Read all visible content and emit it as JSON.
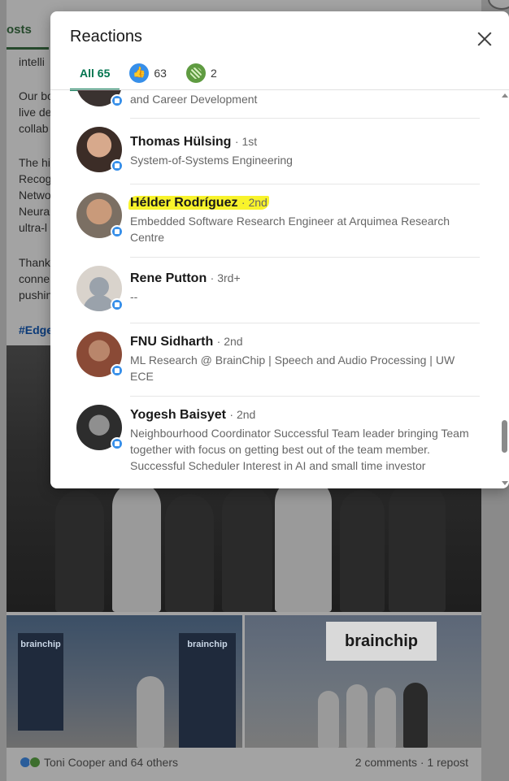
{
  "background_post": {
    "tab_label": "osts",
    "text_lines": [
      "intelli",
      "Our bo",
      "live de",
      "collab",
      "The hi",
      "Recog",
      "Netwo",
      "Neura",
      "ultra-l",
      "Thank",
      "conne",
      "pushin"
    ],
    "hashtag": "#Edge",
    "banner_left": "brainchip",
    "banner_mid": "brainchip",
    "sign_text": "brainchip",
    "footer_reactors": "Toni Cooper and 64 others",
    "footer_stats": "2 comments · 1 repost"
  },
  "modal": {
    "title": "Reactions",
    "tabs": [
      {
        "label": "All 65",
        "icon": ""
      },
      {
        "label": "63",
        "icon": "like-icon"
      },
      {
        "label": "2",
        "icon": "insightful-icon"
      }
    ],
    "items": [
      {
        "name": "",
        "degree": "",
        "headline": "and Career Development"
      },
      {
        "name": "Thomas Hülsing",
        "degree": "· 1st",
        "headline": "System-of-Systems Engineering"
      },
      {
        "name": "Hélder Rodríguez",
        "degree": "· 2nd",
        "headline": "Embedded Software Research Engineer at Arquimea Research Centre"
      },
      {
        "name": "Rene Putton",
        "degree": "· 3rd+",
        "headline": "--"
      },
      {
        "name": "FNU Sidharth",
        "degree": "· 2nd",
        "headline": "ML Research @ BrainChip | Speech and Audio Processing | UW ECE"
      },
      {
        "name": "Yogesh Baisyet",
        "degree": "· 2nd",
        "headline": "Neighbourhood Coordinator Successful Team leader bringing Team together with focus on getting best out of the team member. Successful Scheduler Interest in AI and small time investor"
      }
    ]
  },
  "colors": {
    "accent_green": "#01754f",
    "like_blue": "#378fe9",
    "highlight_yellow": "#f8f32b"
  }
}
